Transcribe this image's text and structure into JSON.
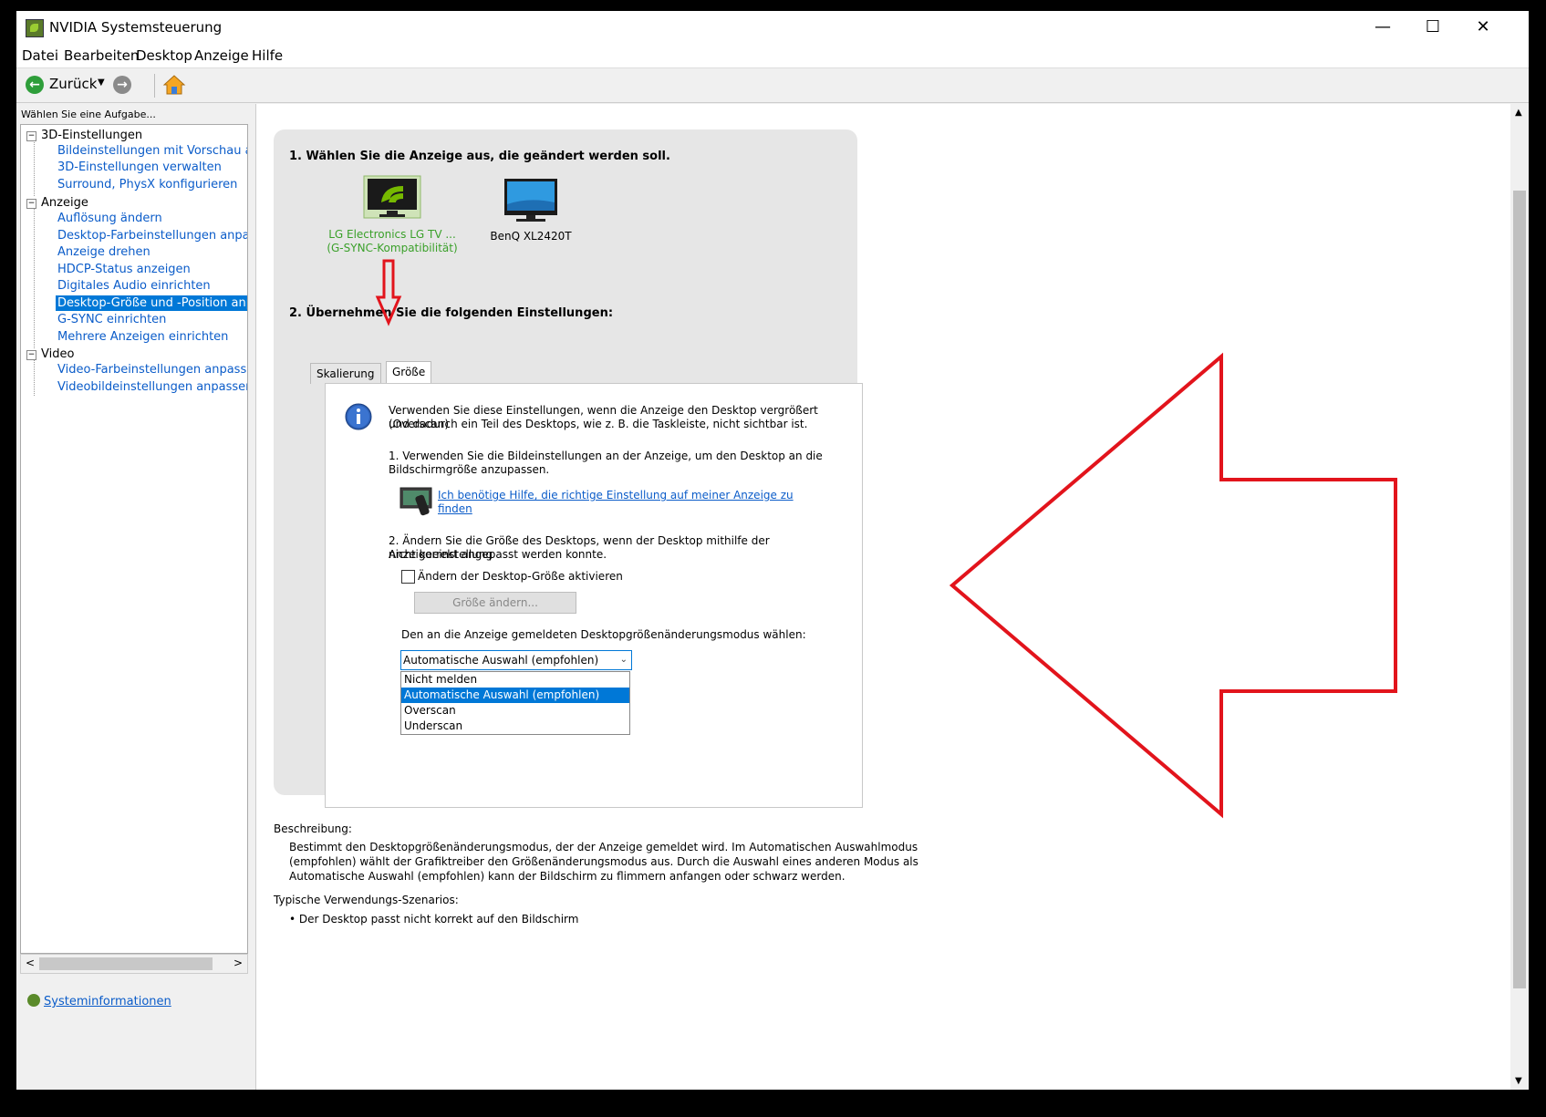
{
  "window": {
    "title": "NVIDIA Systemsteuerung",
    "minimize": "—",
    "maximize": "☐",
    "close": "✕"
  },
  "menu": [
    "Datei",
    "Bearbeiten",
    "Desktop",
    "Anzeige",
    "Hilfe"
  ],
  "toolbar": {
    "back_label": "Zurück",
    "back_icon": "back-arrow-icon",
    "forward_icon": "forward-arrow-icon",
    "home_icon": "home-icon"
  },
  "sidebar": {
    "header": "Wählen Sie eine Aufgabe...",
    "groups": [
      {
        "label": "3D-Einstellungen",
        "toggle": "−",
        "items": [
          "Bildeinstellungen mit Vorschau anpa",
          "3D-Einstellungen verwalten",
          "Surround, PhysX konfigurieren"
        ]
      },
      {
        "label": "Anzeige",
        "toggle": "−",
        "items": [
          "Auflösung ändern",
          "Desktop-Farbeinstellungen anpasser",
          "Anzeige drehen",
          "HDCP-Status anzeigen",
          "Digitales Audio einrichten",
          "Desktop-Größe und -Position anpass",
          "G-SYNC einrichten",
          "Mehrere Anzeigen einrichten"
        ]
      },
      {
        "label": "Video",
        "toggle": "−",
        "items": [
          "Video-Farbeinstellungen anpassen",
          "Videobildeinstellungen anpassen"
        ]
      }
    ],
    "selected": "Desktop-Größe und -Position anpass",
    "scroll_left": "<",
    "scroll_right": ">",
    "sysinfo_label": "Systeminformationen"
  },
  "main": {
    "step1_heading": "1. Wählen Sie die Anzeige aus, die geändert werden soll.",
    "displays": [
      {
        "name": "LG Electronics LG TV ...",
        "subtitle": "(G-SYNC-Kompatibilität)",
        "selected": true
      },
      {
        "name": "BenQ XL2420T",
        "subtitle": "",
        "selected": false
      }
    ],
    "step2_heading": "2. Übernehmen Sie die folgenden Einstellungen:",
    "tabs": [
      "Skalierung",
      "Größe"
    ],
    "active_tab": "Größe",
    "info_line1": "Verwenden Sie diese Einstellungen, wenn die Anzeige den Desktop vergrößert (Overscan)",
    "info_line2": "und dadurch ein Teil des Desktops, wie z. B. die Taskleiste, nicht sichtbar ist.",
    "point1_line1": "1. Verwenden Sie die Bildeinstellungen an der Anzeige, um den Desktop an die",
    "point1_line2": "Bildschirmgröße anzupassen.",
    "help_link_line1": "Ich benötige Hilfe, die richtige Einstellung auf meiner Anzeige zu",
    "help_link_line2": "finden",
    "point2_line1": "2. Ändern Sie die Größe des Desktops, wenn der Desktop mithilfe der Anzeigeeinstellung",
    "point2_line2": "nicht korrekt angepasst werden konnte.",
    "checkbox_label": "Ändern der Desktop-Größe aktivieren",
    "resize_button": "Größe ändern...",
    "mode_label": "Den an die Anzeige gemeldeten Desktopgrößenänderungsmodus wählen:",
    "mode_selected": "Automatische Auswahl (empfohlen)",
    "mode_options": [
      "Nicht melden",
      "Automatische Auswahl (empfohlen)",
      "Overscan",
      "Underscan"
    ],
    "description_label": "Beschreibung:",
    "description_lines": [
      "Bestimmt den Desktopgrößenänderungsmodus, der der Anzeige gemeldet wird. Im Automatischen Auswahlmodus",
      "(empfohlen) wählt der Grafiktreiber den Größenänderungsmodus aus. Durch die Auswahl eines anderen Modus als",
      "Automatische Auswahl (empfohlen) kann der Bildschirm zu flimmern anfangen oder schwarz werden."
    ],
    "scenarios_label": "Typische Verwendungs-Szenarios:",
    "scenario_item": "• Der Desktop passt nicht korrekt auf den Bildschirm"
  },
  "colors": {
    "accent": "#0078d7",
    "link": "#0b5cc9",
    "nvidia_green": "#76b900",
    "annotation_red": "#e2141c"
  }
}
